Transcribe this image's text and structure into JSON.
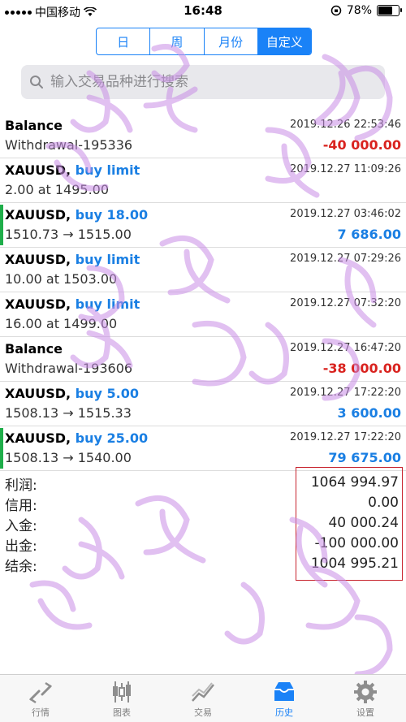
{
  "status": {
    "carrier": "中国移动",
    "time": "16:48",
    "battery": "78%",
    "battery_level": 0.78
  },
  "segment": {
    "tabs": [
      "日",
      "周",
      "月份",
      "自定义"
    ],
    "active": "自定义"
  },
  "search": {
    "placeholder": "输入交易品种进行搜索",
    "value": ""
  },
  "rows": [
    {
      "symbol": "Balance",
      "op": "",
      "detail": "Withdrawal-195336",
      "time": "2019.12.26 22:53:46",
      "amount": "-40 000.00",
      "amount_type": "neg",
      "marked": false
    },
    {
      "symbol": "XAUUSD,",
      "op": "buy limit",
      "detail": "2.00 at 1495.00",
      "time": "2019.12.27 11:09:26",
      "amount": "",
      "amount_type": "",
      "marked": false
    },
    {
      "symbol": "XAUUSD,",
      "op": "buy 18.00",
      "detail": "1510.73 → 1515.00",
      "time": "2019.12.27 03:46:02",
      "amount": "7 686.00",
      "amount_type": "pos",
      "marked": true
    },
    {
      "symbol": "XAUUSD,",
      "op": "buy limit",
      "detail": "10.00 at 1503.00",
      "time": "2019.12.27 07:29:26",
      "amount": "",
      "amount_type": "",
      "marked": false
    },
    {
      "symbol": "XAUUSD,",
      "op": "buy limit",
      "detail": "16.00 at 1499.00",
      "time": "2019.12.27 07:32:20",
      "amount": "",
      "amount_type": "",
      "marked": false
    },
    {
      "symbol": "Balance",
      "op": "",
      "detail": "Withdrawal-193606",
      "time": "2019.12.27 16:47:20",
      "amount": "-38 000.00",
      "amount_type": "neg",
      "marked": false
    },
    {
      "symbol": "XAUUSD,",
      "op": "buy 5.00",
      "detail": "1508.13 → 1515.33",
      "time": "2019.12.27 17:22:20",
      "amount": "3 600.00",
      "amount_type": "pos",
      "marked": false
    },
    {
      "symbol": "XAUUSD,",
      "op": "buy 25.00",
      "detail": "1508.13 → 1540.00",
      "time": "2019.12.27 17:22:20",
      "amount": "79 675.00",
      "amount_type": "pos",
      "marked": true
    }
  ],
  "summary": {
    "labels": [
      "利润:",
      "信用:",
      "入金:",
      "出金:",
      "结余:"
    ],
    "values": [
      "1064 994.97",
      "0.00",
      "40 000.24",
      "-100 000.00",
      "1004 995.21"
    ]
  },
  "tabbar": [
    {
      "label": "行情",
      "icon": "quotes-icon",
      "active": false
    },
    {
      "label": "图表",
      "icon": "chart-icon",
      "active": false
    },
    {
      "label": "交易",
      "icon": "trade-icon",
      "active": false
    },
    {
      "label": "历史",
      "icon": "history-icon",
      "active": true
    },
    {
      "label": "设置",
      "icon": "settings-icon",
      "active": false
    }
  ],
  "colors": {
    "accent": "#1a82f7",
    "negative": "#d9231f",
    "positive": "#1a7fe3",
    "marker": "#1fae4a",
    "highlight_box": "#c8242e"
  }
}
